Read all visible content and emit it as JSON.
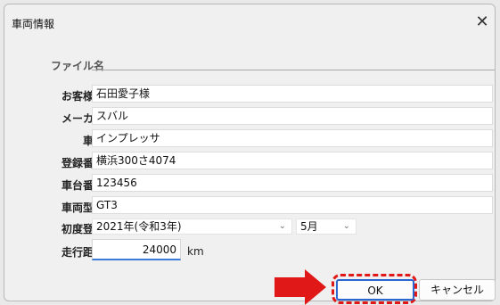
{
  "window": {
    "title": "車両情報",
    "close_icon": "close-icon"
  },
  "fields": {
    "file_name": {
      "label": "ファイル名",
      "value": ""
    },
    "customer_name": {
      "label": "お客様名",
      "value": "石田愛子様"
    },
    "maker": {
      "label": "メーカー",
      "value": "スバル"
    },
    "model": {
      "label": "車種",
      "value": "インプレッサ"
    },
    "registration_number": {
      "label": "登録番号",
      "value": "横浜300さ4074"
    },
    "chassis_number": {
      "label": "車台番号",
      "value": "123456"
    },
    "vehicle_type": {
      "label": "車両型式",
      "value": "GT3"
    },
    "first_registration": {
      "label": "初度登録",
      "year": "2021年(令和3年)",
      "month": "5月"
    },
    "mileage": {
      "label": "走行距離",
      "value": "24000",
      "unit": "km"
    }
  },
  "buttons": {
    "ok": "OK",
    "cancel": "キャンセル"
  },
  "annotation": {
    "arrow_color": "#e01818",
    "highlight_color": "#e01818"
  }
}
